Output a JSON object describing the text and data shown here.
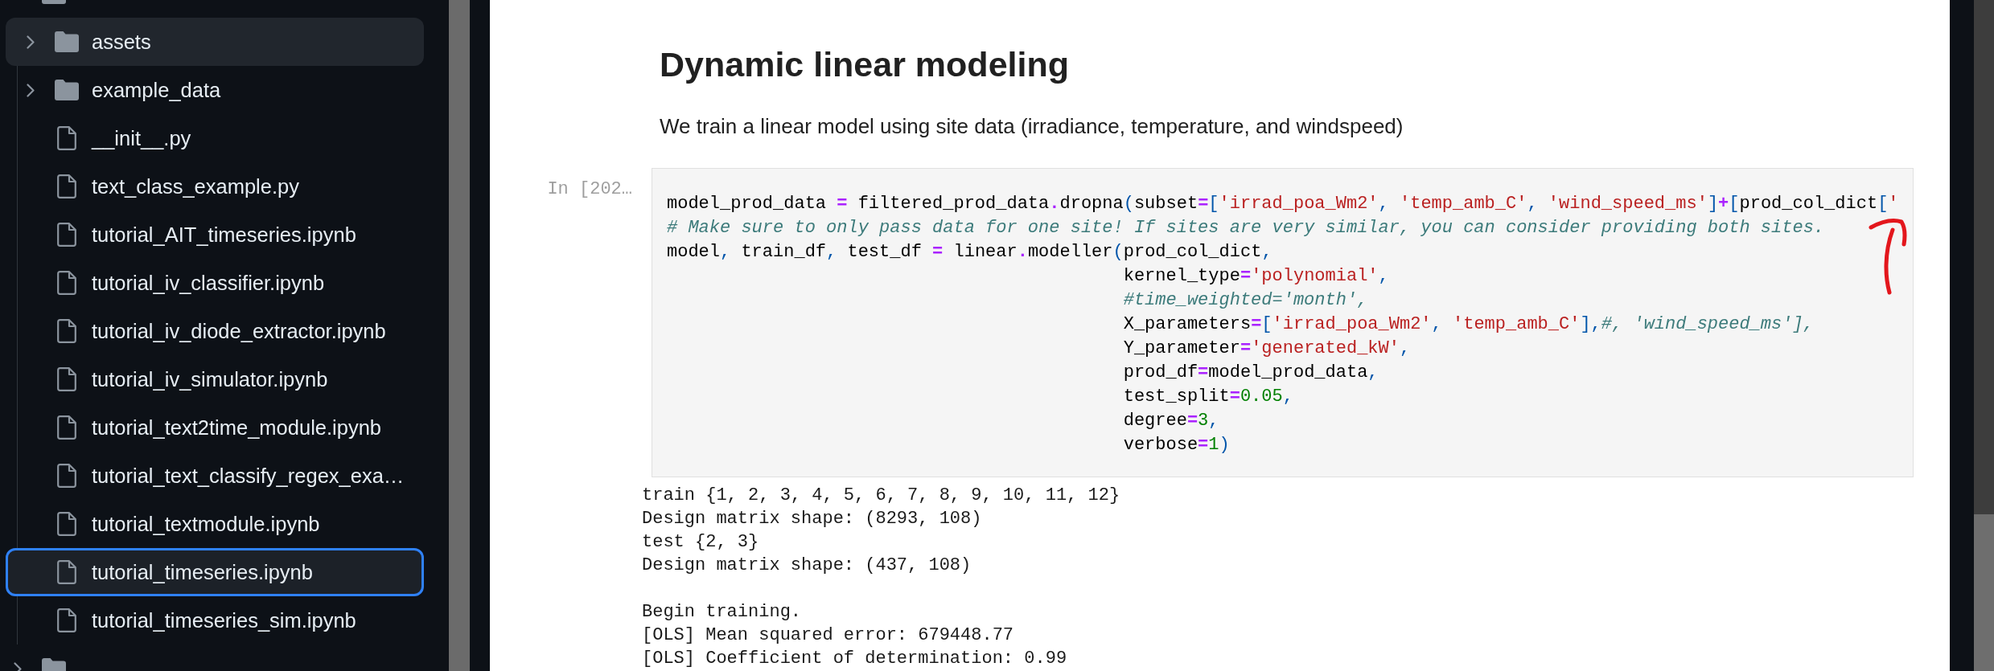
{
  "file_browser": {
    "items": [
      {
        "kind": "folder",
        "expanded": true,
        "selected": false,
        "hovered": false,
        "children": [
          {
            "name": "assets",
            "kind": "folder",
            "expanded": false,
            "selected": false,
            "hovered": true
          },
          {
            "name": "example_data",
            "kind": "folder",
            "expanded": false,
            "selected": false,
            "hovered": false
          },
          {
            "name": "__init__.py",
            "kind": "file",
            "selected": false,
            "hovered": false
          },
          {
            "name": "text_class_example.py",
            "kind": "file",
            "selected": false,
            "hovered": false
          },
          {
            "name": "tutorial_AIT_timeseries.ipynb",
            "kind": "file",
            "selected": false,
            "hovered": false
          },
          {
            "name": "tutorial_iv_classifier.ipynb",
            "kind": "file",
            "selected": false,
            "hovered": false
          },
          {
            "name": "tutorial_iv_diode_extractor.ipynb",
            "kind": "file",
            "selected": false,
            "hovered": false
          },
          {
            "name": "tutorial_iv_simulator.ipynb",
            "kind": "file",
            "selected": false,
            "hovered": false
          },
          {
            "name": "tutorial_text2time_module.ipynb",
            "kind": "file",
            "selected": false,
            "hovered": false
          },
          {
            "name": "tutorial_text_classify_regex_exa…",
            "kind": "file",
            "selected": false,
            "hovered": false
          },
          {
            "name": "tutorial_textmodule.ipynb",
            "kind": "file",
            "selected": false,
            "hovered": false
          },
          {
            "name": "tutorial_timeseries.ipynb",
            "kind": "file",
            "selected": true,
            "hovered": false
          },
          {
            "name": "tutorial_timeseries_sim.ipynb",
            "kind": "file",
            "selected": false,
            "hovered": false
          }
        ]
      },
      {
        "kind": "folder",
        "expanded": false,
        "selected": false,
        "hovered": false
      }
    ]
  },
  "notebook": {
    "heading": "Dynamic linear modeling",
    "paragraph": "We train a linear model using site data (irradiance, temperature, and windspeed)",
    "code_cell": {
      "prompt": "In [202…",
      "lines": [
        [
          {
            "kind": "name",
            "text": "model_prod_data "
          },
          {
            "kind": "operator",
            "text": "="
          },
          {
            "kind": "name",
            "text": " filtered_prod_data"
          },
          {
            "kind": "operator",
            "text": "."
          },
          {
            "kind": "name",
            "text": "dropna"
          },
          {
            "kind": "punctuation",
            "text": "("
          },
          {
            "kind": "name",
            "text": "subset"
          },
          {
            "kind": "operator",
            "text": "="
          },
          {
            "kind": "punctuation",
            "text": "["
          },
          {
            "kind": "string",
            "text": "'irrad_poa_Wm2'"
          },
          {
            "kind": "punctuation",
            "text": ", "
          },
          {
            "kind": "string",
            "text": "'temp_amb_C'"
          },
          {
            "kind": "punctuation",
            "text": ", "
          },
          {
            "kind": "string",
            "text": "'wind_speed_ms'"
          },
          {
            "kind": "punctuation",
            "text": "]"
          },
          {
            "kind": "operator",
            "text": "+"
          },
          {
            "kind": "punctuation",
            "text": "["
          },
          {
            "kind": "name",
            "text": "prod_col_dict"
          },
          {
            "kind": "punctuation",
            "text": "["
          },
          {
            "kind": "string",
            "text": "'"
          }
        ],
        [
          {
            "kind": "comment",
            "text": "# Make sure to only pass data for one site! If sites are very similar, you can consider providing both sites."
          }
        ],
        [
          {
            "kind": "name",
            "text": "model"
          },
          {
            "kind": "punctuation",
            "text": ", "
          },
          {
            "kind": "name",
            "text": "train_df"
          },
          {
            "kind": "punctuation",
            "text": ", "
          },
          {
            "kind": "name",
            "text": "test_df "
          },
          {
            "kind": "operator",
            "text": "="
          },
          {
            "kind": "name",
            "text": " linear"
          },
          {
            "kind": "operator",
            "text": "."
          },
          {
            "kind": "name",
            "text": "modeller"
          },
          {
            "kind": "punctuation",
            "text": "("
          },
          {
            "kind": "name",
            "text": "prod_col_dict"
          },
          {
            "kind": "punctuation",
            "text": ","
          }
        ],
        [
          {
            "kind": "name",
            "text": "                                           kernel_type"
          },
          {
            "kind": "operator",
            "text": "="
          },
          {
            "kind": "string",
            "text": "'polynomial'"
          },
          {
            "kind": "punctuation",
            "text": ","
          }
        ],
        [
          {
            "kind": "comment",
            "text": "                                           #time_weighted='month',"
          }
        ],
        [
          {
            "kind": "name",
            "text": "                                           X_parameters"
          },
          {
            "kind": "operator",
            "text": "="
          },
          {
            "kind": "punctuation",
            "text": "["
          },
          {
            "kind": "string",
            "text": "'irrad_poa_Wm2'"
          },
          {
            "kind": "punctuation",
            "text": ", "
          },
          {
            "kind": "string",
            "text": "'temp_amb_C'"
          },
          {
            "kind": "punctuation",
            "text": "],"
          },
          {
            "kind": "comment",
            "text": "#, 'wind_speed_ms'],"
          }
        ],
        [
          {
            "kind": "name",
            "text": "                                           Y_parameter"
          },
          {
            "kind": "operator",
            "text": "="
          },
          {
            "kind": "string",
            "text": "'generated_kW'"
          },
          {
            "kind": "punctuation",
            "text": ","
          }
        ],
        [
          {
            "kind": "name",
            "text": "                                           prod_df"
          },
          {
            "kind": "operator",
            "text": "="
          },
          {
            "kind": "name",
            "text": "model_prod_data"
          },
          {
            "kind": "punctuation",
            "text": ","
          }
        ],
        [
          {
            "kind": "name",
            "text": "                                           test_split"
          },
          {
            "kind": "operator",
            "text": "="
          },
          {
            "kind": "number",
            "text": "0.05"
          },
          {
            "kind": "punctuation",
            "text": ","
          }
        ],
        [
          {
            "kind": "name",
            "text": "                                           degree"
          },
          {
            "kind": "operator",
            "text": "="
          },
          {
            "kind": "number",
            "text": "3"
          },
          {
            "kind": "punctuation",
            "text": ","
          }
        ],
        [
          {
            "kind": "name",
            "text": "                                           verbose"
          },
          {
            "kind": "operator",
            "text": "="
          },
          {
            "kind": "number",
            "text": "1"
          },
          {
            "kind": "punctuation",
            "text": ")"
          }
        ]
      ]
    },
    "output": {
      "blocks": [
        [
          "train {1, 2, 3, 4, 5, 6, 7, 8, 9, 10, 11, 12}",
          "Design matrix shape: (8293, 108)",
          "test {2, 3}",
          "Design matrix shape: (437, 108)"
        ],
        [
          "Begin training.",
          "[OLS] Mean squared error: 679448.77",
          "[OLS] Coefficient of determination: 0.99"
        ]
      ]
    }
  }
}
